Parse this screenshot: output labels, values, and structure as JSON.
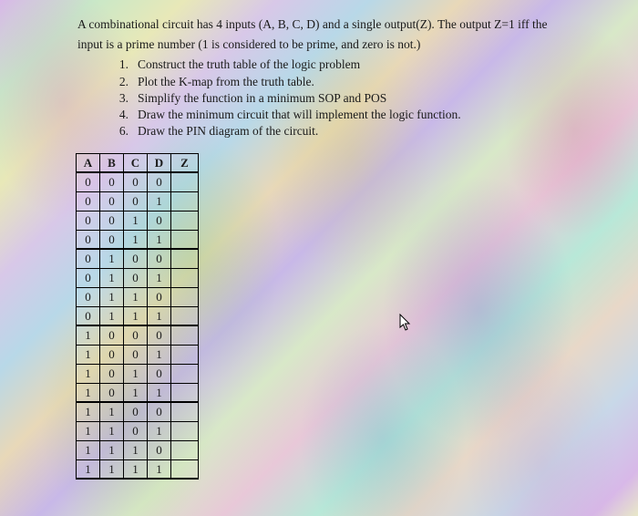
{
  "problem": {
    "line1": "A combinational circuit has 4 inputs (A, B, C, D) and a single output(Z). The output Z=1 iff the",
    "line2": "input is a prime number (1 is considered to be prime, and zero is not.)"
  },
  "tasks": [
    {
      "num": "1.",
      "text": "Construct the truth table of the logic problem"
    },
    {
      "num": "2.",
      "text": "Plot the K-map from the truth table."
    },
    {
      "num": "3.",
      "text": "Simplify the function in a minimum SOP and POS"
    },
    {
      "num": "4.",
      "text": "Draw the minimum circuit that will implement the logic function."
    },
    {
      "num": "6.",
      "text": "Draw the PIN diagram of the circuit."
    }
  ],
  "table": {
    "headers": [
      "A",
      "B",
      "C",
      "D",
      "Z"
    ],
    "rows": [
      [
        "0",
        "0",
        "0",
        "0",
        ""
      ],
      [
        "0",
        "0",
        "0",
        "1",
        ""
      ],
      [
        "0",
        "0",
        "1",
        "0",
        ""
      ],
      [
        "0",
        "0",
        "1",
        "1",
        ""
      ],
      [
        "0",
        "1",
        "0",
        "0",
        ""
      ],
      [
        "0",
        "1",
        "0",
        "1",
        ""
      ],
      [
        "0",
        "1",
        "1",
        "0",
        ""
      ],
      [
        "0",
        "1",
        "1",
        "1",
        ""
      ],
      [
        "1",
        "0",
        "0",
        "0",
        ""
      ],
      [
        "1",
        "0",
        "0",
        "1",
        ""
      ],
      [
        "1",
        "0",
        "1",
        "0",
        ""
      ],
      [
        "1",
        "0",
        "1",
        "1",
        ""
      ],
      [
        "1",
        "1",
        "0",
        "0",
        ""
      ],
      [
        "1",
        "1",
        "0",
        "1",
        ""
      ],
      [
        "1",
        "1",
        "1",
        "0",
        ""
      ],
      [
        "1",
        "1",
        "1",
        "1",
        ""
      ]
    ]
  }
}
